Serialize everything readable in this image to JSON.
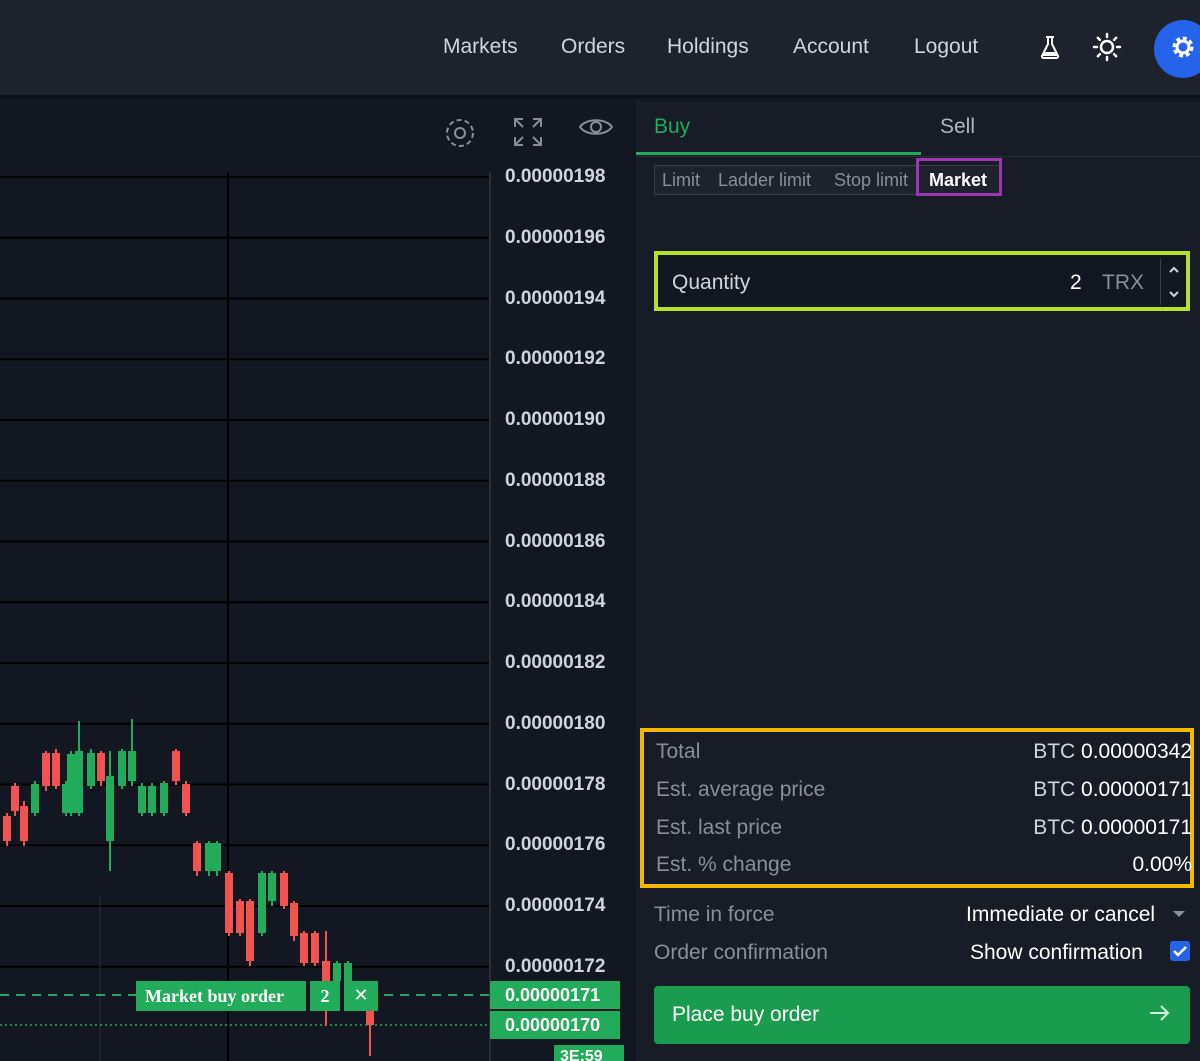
{
  "nav": {
    "markets": "Markets",
    "orders": "Orders",
    "holdings": "Holdings",
    "account": "Account",
    "logout": "Logout"
  },
  "icons": {
    "lab": "flask-icon",
    "theme": "sun-icon",
    "settings": "gear-icon"
  },
  "chart": {
    "price_axis": [
      "0.00000198",
      "0.00000196",
      "0.00000194",
      "0.00000192",
      "0.00000190",
      "0.00000188",
      "0.00000186",
      "0.00000184",
      "0.00000182",
      "0.00000180",
      "0.00000178",
      "0.00000176",
      "0.00000174",
      "0.00000172"
    ],
    "order_price_tag": "0.00000171",
    "last_price_tag": "0.00000170",
    "time_tag": "3E:59",
    "order_line": {
      "label": "Market buy order",
      "qty": "2",
      "close": "✕"
    }
  },
  "panel": {
    "tabs": {
      "buy": "Buy",
      "sell": "Sell"
    },
    "order_types": [
      "Limit",
      "Ladder limit",
      "Stop limit",
      "Market"
    ],
    "active_order_type": "Market",
    "quantity": {
      "label": "Quantity",
      "value": "2",
      "unit": "TRX"
    },
    "summary": {
      "total_label": "Total",
      "total_cur": "BTC",
      "total_val": "0.00000342",
      "avg_label": "Est. average price",
      "avg_cur": "BTC",
      "avg_val": "0.00000171",
      "last_label": "Est. last price",
      "last_cur": "BTC",
      "last_val": "0.00000171",
      "change_label": "Est. % change",
      "change_val": "0.00%"
    },
    "time_in_force": {
      "label": "Time in force",
      "value": "Immediate or cancel"
    },
    "confirmation": {
      "label": "Order confirmation",
      "value": "Show confirmation",
      "checked": true
    },
    "place_order": "Place buy order"
  },
  "colors": {
    "buy_green": "#22ab5a",
    "sell_red": "#f05350",
    "accent_blue": "#2563eb",
    "highlight_purple": "#9c36b5",
    "highlight_lime": "#b4e12a",
    "highlight_amber": "#f5b800"
  }
}
